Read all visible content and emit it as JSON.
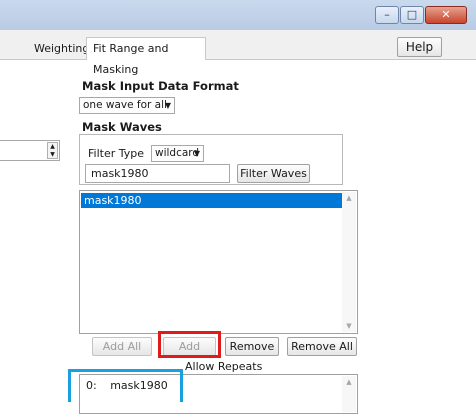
{
  "window": {
    "controls": {
      "minimize_glyph": "–",
      "maximize_glyph": "□",
      "close_glyph": "✕"
    }
  },
  "tabs": [
    {
      "label": "Weighting",
      "active": false
    },
    {
      "label": "Fit Range and Masking",
      "active": true
    }
  ],
  "help_label": "Help",
  "mask_input": {
    "heading": "Mask Input Data Format",
    "format_value": "one wave for all",
    "arrow": "▼"
  },
  "mask_waves": {
    "heading": "Mask Waves",
    "filter_type_label": "Filter Type",
    "filter_type_value": "wildcard",
    "arrow": "▼",
    "filter_text": "mask1980",
    "filter_button": "Filter Waves"
  },
  "wave_list": {
    "items": [
      "mask1980"
    ],
    "selected_index": 0,
    "scroll_up": "▲",
    "scroll_down": "▼"
  },
  "list_buttons": {
    "add_all": "Add All",
    "add": "Add",
    "remove": "Remove",
    "remove_all": "Remove All"
  },
  "allow_repeats_label": "Allow Repeats",
  "selected_list": {
    "items": [
      {
        "index": "0:",
        "name": "mask1980"
      }
    ],
    "scroll_up": "▲"
  },
  "stepper": {
    "up": "▲",
    "down": "▼"
  },
  "colors": {
    "selection": "#0078d7",
    "highlight_red": "#e01b1b",
    "highlight_blue": "#1aa0e0"
  }
}
